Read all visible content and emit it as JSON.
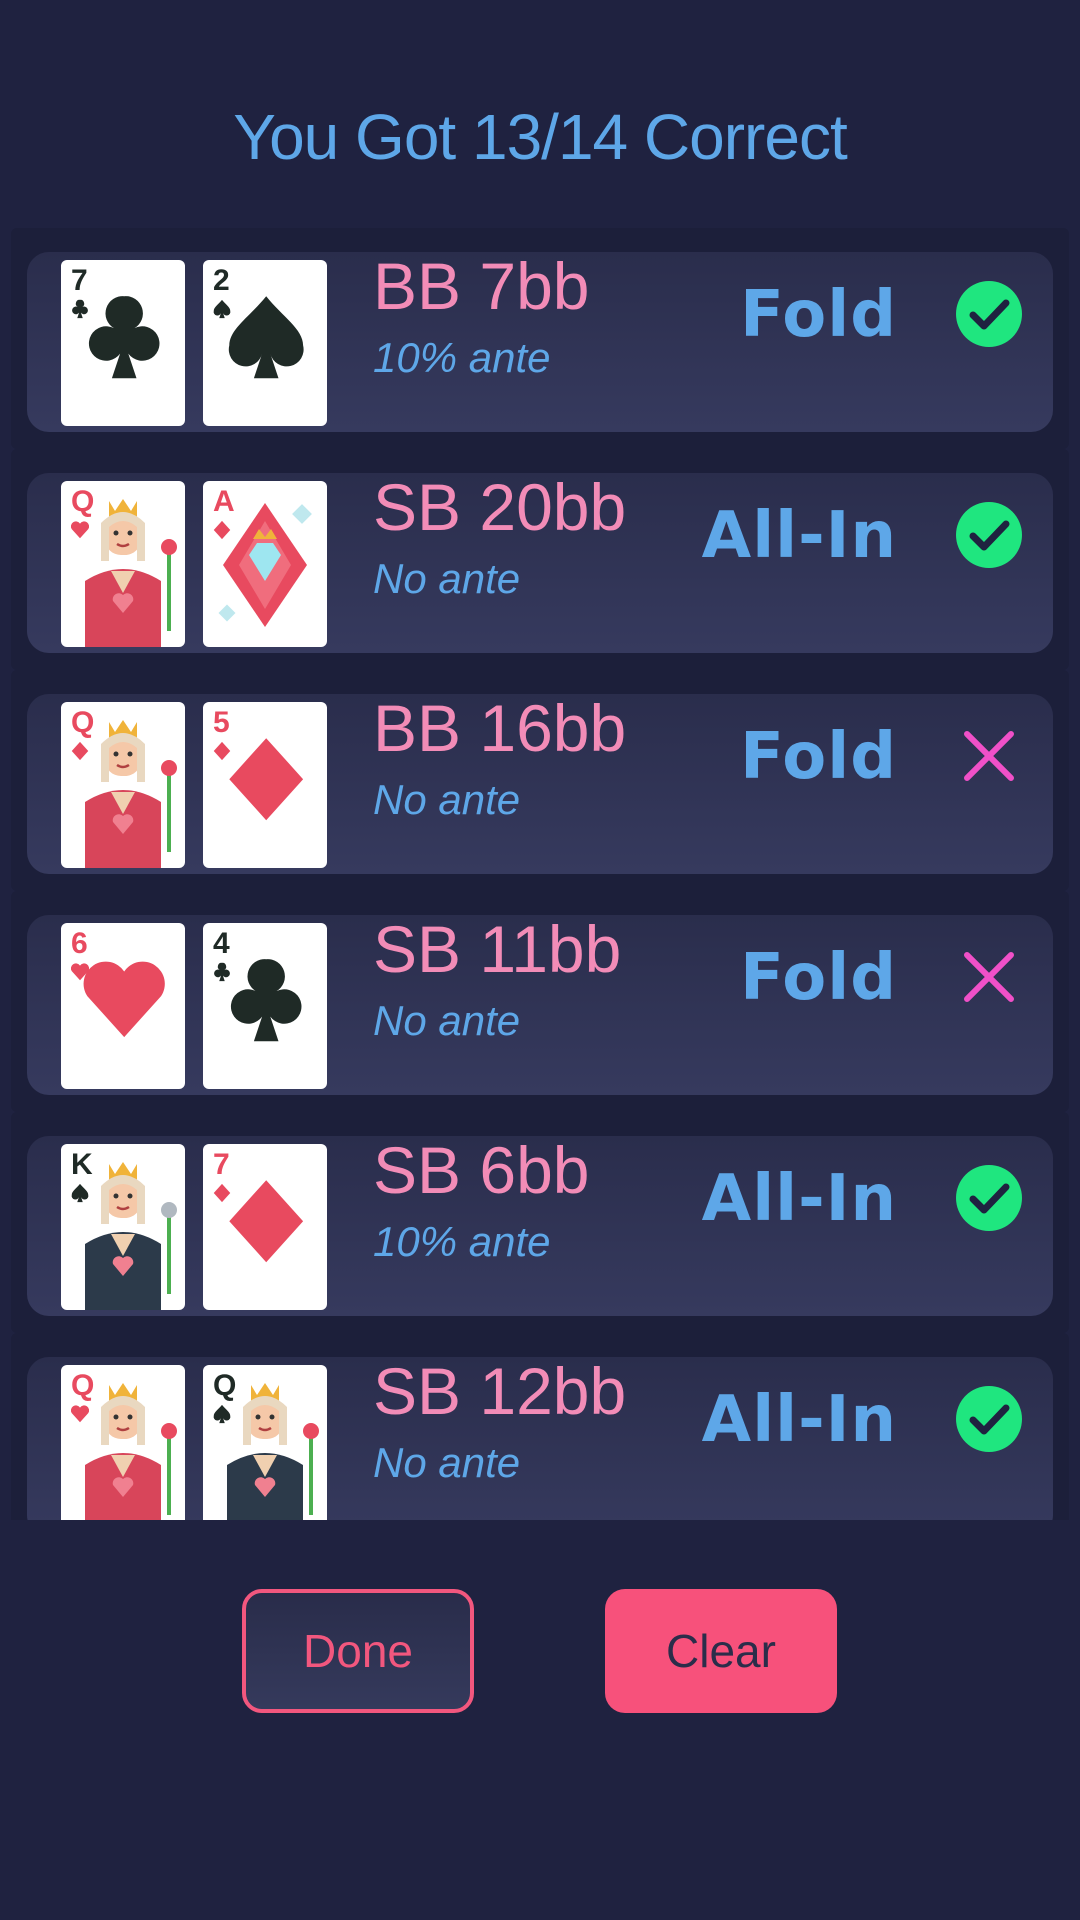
{
  "header": {
    "title": "You Got 13/14 Correct"
  },
  "hands": [
    {
      "card1": {
        "rank": "7",
        "suit": "clubs",
        "color": "#1f2a26"
      },
      "card2": {
        "rank": "2",
        "suit": "spades",
        "color": "#1f2a26"
      },
      "spot": "BB 7bb",
      "ante": "10% ante",
      "action": "Fold",
      "result": "correct"
    },
    {
      "card1": {
        "rank": "Q",
        "suit": "hearts",
        "color": "#e84a5f"
      },
      "card2": {
        "rank": "A",
        "suit": "diamonds",
        "color": "#e84a5f"
      },
      "spot": "SB 20bb",
      "ante": "No ante",
      "action": "All-In",
      "result": "correct"
    },
    {
      "card1": {
        "rank": "Q",
        "suit": "diamonds",
        "color": "#e84a5f"
      },
      "card2": {
        "rank": "5",
        "suit": "diamonds",
        "color": "#e84a5f"
      },
      "spot": "BB 16bb",
      "ante": "No ante",
      "action": "Fold",
      "result": "wrong"
    },
    {
      "card1": {
        "rank": "6",
        "suit": "hearts",
        "color": "#e84a5f"
      },
      "card2": {
        "rank": "4",
        "suit": "clubs",
        "color": "#1f2a26"
      },
      "spot": "SB 11bb",
      "ante": "No ante",
      "action": "Fold",
      "result": "wrong"
    },
    {
      "card1": {
        "rank": "K",
        "suit": "spades",
        "color": "#1f2a26"
      },
      "card2": {
        "rank": "7",
        "suit": "diamonds",
        "color": "#e84a5f"
      },
      "spot": "SB 6bb",
      "ante": "10% ante",
      "action": "All-In",
      "result": "correct"
    },
    {
      "card1": {
        "rank": "Q",
        "suit": "hearts",
        "color": "#e84a5f"
      },
      "card2": {
        "rank": "Q",
        "suit": "spades",
        "color": "#1f2a26"
      },
      "spot": "SB 12bb",
      "ante": "No ante",
      "action": "All-In",
      "result": "correct"
    }
  ],
  "buttons": {
    "done_label": "Done",
    "clear_label": "Clear"
  },
  "icons": {
    "correct": "check-circle-icon",
    "wrong": "x-mark-icon"
  },
  "colors": {
    "background": "#1f2240",
    "title": "#5ea7e8",
    "spot_text": "#f28cb7",
    "ante_text": "#5ea7e8",
    "action_text": "#5ea7e8",
    "correct": "#1fe67f",
    "wrong": "#f050c8",
    "accent": "#f7517b"
  }
}
